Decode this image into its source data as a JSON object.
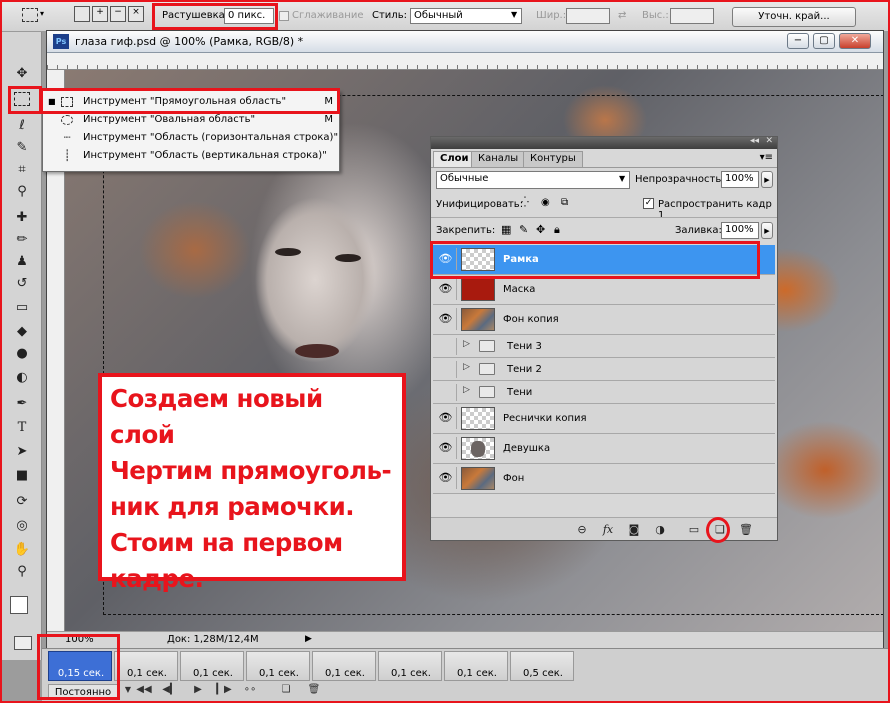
{
  "options_bar": {
    "feather_label": "Растушевка:",
    "feather_value": "0 пикс.",
    "antialias_label": "Сглаживание",
    "style_label": "Стиль:",
    "style_value": "Обычный",
    "width_label": "Шир.:",
    "height_label": "Выс.:",
    "refine_edge_button": "Уточн. край..."
  },
  "document": {
    "title": "глаза гиф.psd @ 100% (Рамка, RGB/8) *",
    "ps_badge": "Ps",
    "zoom": "100%",
    "doc_size": "Док: 1,28M/12,4M"
  },
  "tool_flyout": {
    "items": [
      {
        "label": "Инструмент \"Прямоугольная область\"",
        "shortcut": "M",
        "icon": "rect-marquee-icon"
      },
      {
        "label": "Инструмент \"Овальная область\"",
        "shortcut": "M",
        "icon": "ellipse-marquee-icon"
      },
      {
        "label": "Инструмент \"Область (горизонтальная строка)\"",
        "shortcut": "",
        "icon": "single-row-marquee-icon"
      },
      {
        "label": "Инструмент \"Область (вертикальная строка)\"",
        "shortcut": "",
        "icon": "single-column-marquee-icon"
      }
    ]
  },
  "layers_panel": {
    "tabs": [
      "Слои",
      "Каналы",
      "Контуры"
    ],
    "blend_mode": "Обычные",
    "opacity_label": "Непрозрачность:",
    "opacity_value": "100%",
    "unify_label": "Унифицировать:",
    "propagate_label": "Распространить кадр 1",
    "lock_label": "Закрепить:",
    "fill_label": "Заливка:",
    "fill_value": "100%",
    "layers": [
      {
        "name": "Рамка",
        "visible": true,
        "selected": true,
        "thumb": "transparent"
      },
      {
        "name": "Маска",
        "visible": true,
        "selected": false,
        "thumb": "#a81a0e"
      },
      {
        "name": "Фон копия",
        "visible": true,
        "selected": false,
        "thumb": "photo"
      },
      {
        "name": "Тени 3",
        "visible": false,
        "group": true
      },
      {
        "name": "Тени 2",
        "visible": false,
        "group": true
      },
      {
        "name": "Тени",
        "visible": false,
        "group": true
      },
      {
        "name": "Реснички копия",
        "visible": true,
        "selected": false,
        "thumb": "transparent"
      },
      {
        "name": "Девушка",
        "visible": true,
        "selected": false,
        "thumb": "girl"
      },
      {
        "name": "Фон",
        "visible": true,
        "selected": false,
        "thumb": "photo"
      }
    ]
  },
  "caption": "Создаем новый слой\nЧертим прямоуголь-\nник для рамочки.\nСтоим на первом\nкадре.",
  "animation": {
    "frames": [
      "0,15 сек.",
      "0,1 сек.",
      "0,1 сек.",
      "0,1 сек.",
      "0,1 сек.",
      "0,1 сек.",
      "0,1 сек.",
      "0,5 сек."
    ],
    "loop_value": "Постоянно"
  },
  "colors": {
    "highlight": "#e8141c",
    "selection": "#3d95f0"
  }
}
